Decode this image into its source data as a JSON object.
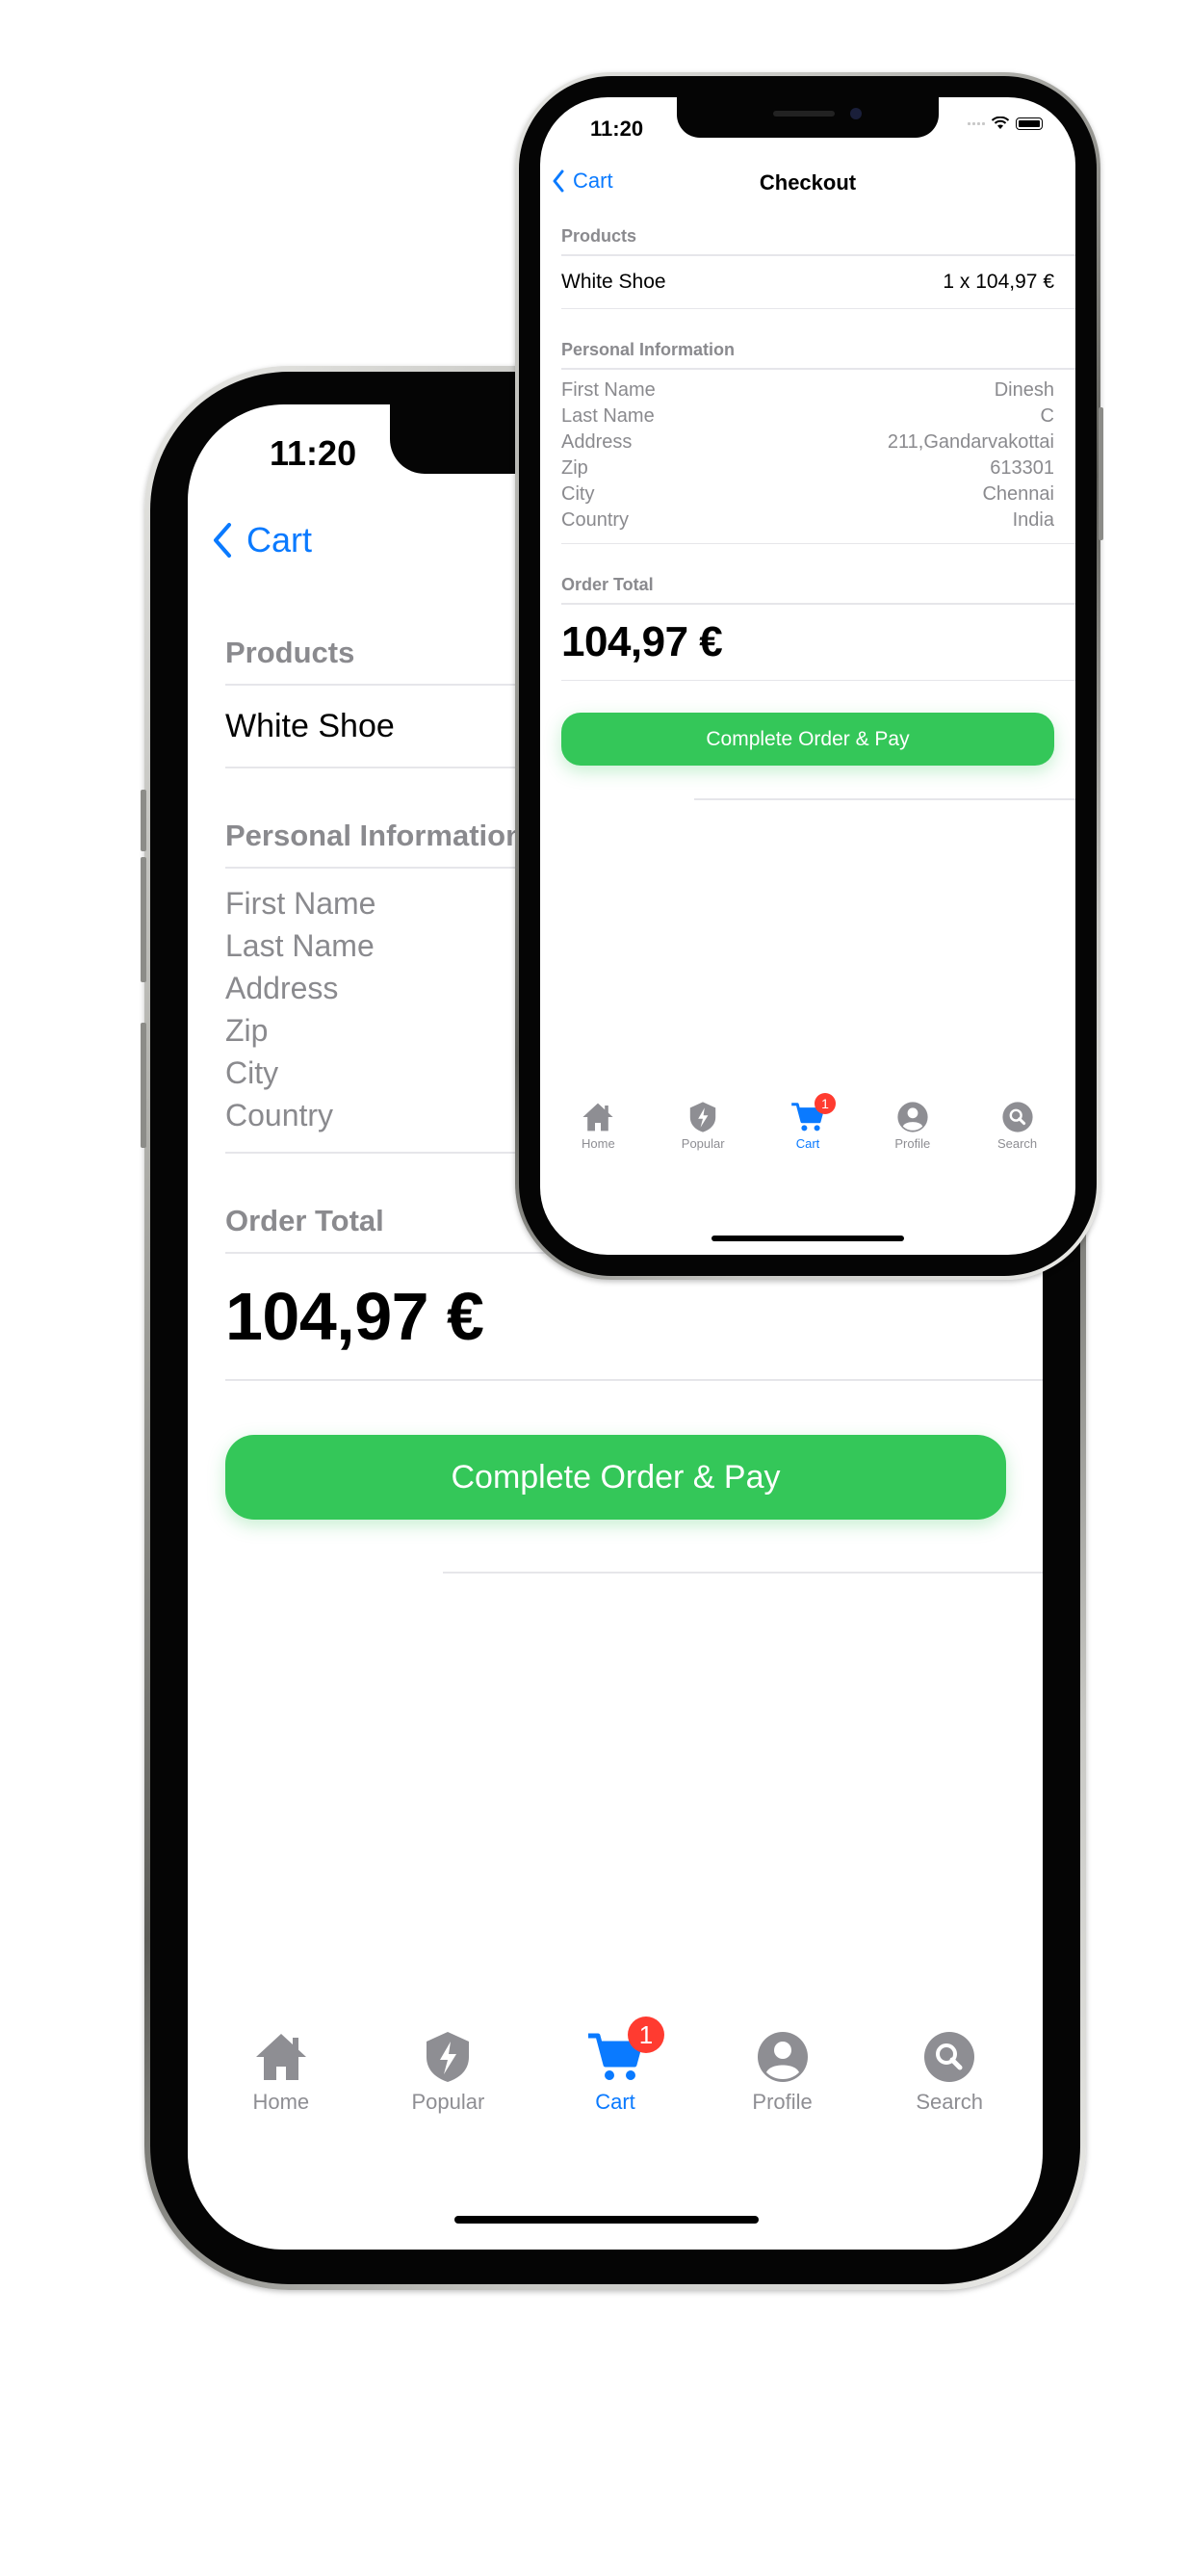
{
  "status": {
    "time": "11:20"
  },
  "nav": {
    "back_label": "Cart",
    "title": "Checkout"
  },
  "products": {
    "header": "Products",
    "items": [
      {
        "name": "White Shoe",
        "qty_price": "1 x 104,97 €"
      }
    ]
  },
  "personal": {
    "header": "Personal Information",
    "fields": [
      {
        "label": "First Name",
        "value": "Dinesh"
      },
      {
        "label": "Last Name",
        "value": "C"
      },
      {
        "label": "Address",
        "value": "211,Gandarvakottai"
      },
      {
        "label": "Zip",
        "value": "613301"
      },
      {
        "label": "City",
        "value": "Chennai"
      },
      {
        "label": "Country",
        "value": "India"
      }
    ]
  },
  "order": {
    "header": "Order Total",
    "total": "104,97 €"
  },
  "actions": {
    "pay_label": "Complete Order & Pay"
  },
  "tabbar": {
    "items": [
      {
        "label": "Home",
        "icon": "house-icon"
      },
      {
        "label": "Popular",
        "icon": "bolt-shield-icon"
      },
      {
        "label": "Cart",
        "icon": "cart-icon",
        "badge": "1",
        "active": true
      },
      {
        "label": "Profile",
        "icon": "person-circle-icon"
      },
      {
        "label": "Search",
        "icon": "search-circle-icon"
      }
    ]
  },
  "colors": {
    "accent": "#0A7AFF",
    "pay_button": "#34C759",
    "badge": "#FF3B30",
    "secondary_text": "#8A8A8E"
  }
}
